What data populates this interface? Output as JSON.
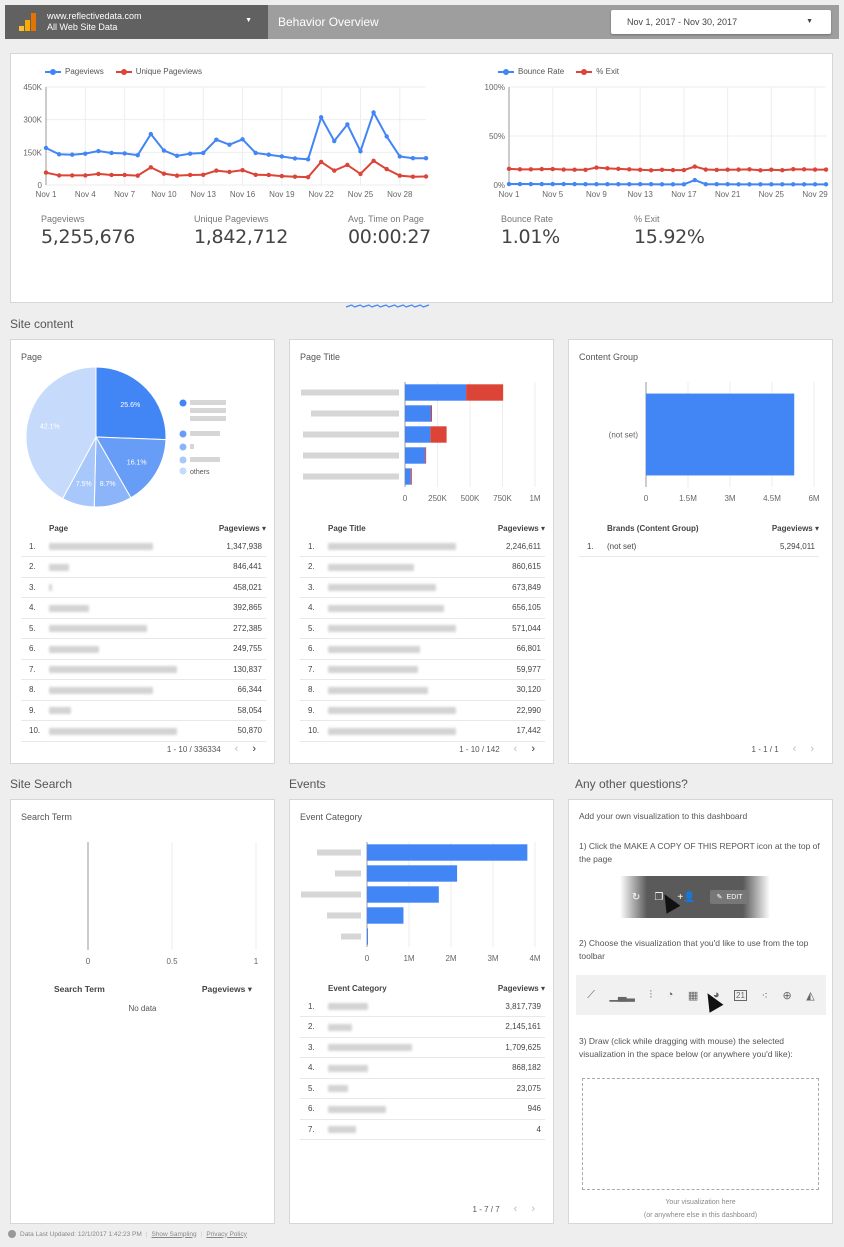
{
  "header": {
    "site": "www.reflectivedata.com",
    "view": "All Web Site Data",
    "title": "Behavior Overview",
    "date_range": "Nov 1, 2017 - Nov 30, 2017"
  },
  "colors": {
    "blue": "#4285f4",
    "red": "#db4437",
    "pie": [
      "#4285f4",
      "#679df6",
      "#8cb4f8",
      "#a8c7fa",
      "#c6dafc"
    ]
  },
  "overview": {
    "scorecards": [
      {
        "label": "Pageviews",
        "value": "5,255,676"
      },
      {
        "label": "Unique Pageviews",
        "value": "1,842,712"
      },
      {
        "label": "Avg. Time on Page",
        "value": "00:00:27"
      },
      {
        "label": "Bounce Rate",
        "value": "1.01%"
      },
      {
        "label": "% Exit",
        "value": "15.92%"
      }
    ]
  },
  "sections": {
    "site_content": "Site content",
    "site_search": "Site Search",
    "events": "Events",
    "questions": "Any other questions?"
  },
  "page_card": {
    "title": "Page",
    "legend_others": "others",
    "table": {
      "headers": [
        "Page",
        "Pageviews ▾"
      ],
      "rows": [
        {
          "n": "1.",
          "name_width": 104,
          "value": "1,347,938"
        },
        {
          "n": "2.",
          "name_width": 20,
          "value": "846,441"
        },
        {
          "n": "3.",
          "name_width": 3,
          "value": "458,021"
        },
        {
          "n": "4.",
          "name_width": 40,
          "value": "392,865"
        },
        {
          "n": "5.",
          "name_width": 98,
          "value": "272,385"
        },
        {
          "n": "6.",
          "name_width": 50,
          "value": "249,755"
        },
        {
          "n": "7.",
          "name_width": 128,
          "value": "130,837"
        },
        {
          "n": "8.",
          "name_width": 104,
          "value": "66,344"
        },
        {
          "n": "9.",
          "name_width": 22,
          "value": "58,054"
        },
        {
          "n": "10.",
          "name_width": 128,
          "value": "50,870"
        }
      ],
      "pager": "1 - 10 / 336334"
    }
  },
  "page_title_card": {
    "title": "Page Title",
    "table": {
      "headers": [
        "Page Title",
        "Pageviews ▾"
      ],
      "rows": [
        {
          "n": "1.",
          "name_width": 128,
          "value": "2,246,611"
        },
        {
          "n": "2.",
          "name_width": 86,
          "value": "860,615"
        },
        {
          "n": "3.",
          "name_width": 108,
          "value": "673,849"
        },
        {
          "n": "4.",
          "name_width": 116,
          "value": "656,105"
        },
        {
          "n": "5.",
          "name_width": 128,
          "value": "571,044"
        },
        {
          "n": "6.",
          "name_width": 92,
          "value": "66,801"
        },
        {
          "n": "7.",
          "name_width": 90,
          "value": "59,977"
        },
        {
          "n": "8.",
          "name_width": 100,
          "value": "30,120"
        },
        {
          "n": "9.",
          "name_width": 128,
          "value": "22,990"
        },
        {
          "n": "10.",
          "name_width": 128,
          "value": "17,442"
        }
      ],
      "pager": "1 - 10 / 142"
    }
  },
  "content_group_card": {
    "title": "Content Group",
    "table": {
      "headers": [
        "Brands (Content Group)",
        "Pageviews ▾"
      ],
      "rows": [
        {
          "n": "1.",
          "name": "(not set)",
          "value": "5,294,011"
        }
      ],
      "pager": "1 - 1 / 1"
    }
  },
  "search_card": {
    "title": "Search Term",
    "table": {
      "headers": [
        "Search Term",
        "Pageviews ▾"
      ],
      "empty": "No data"
    }
  },
  "events_card": {
    "title": "Event Category",
    "table": {
      "headers": [
        "Event Category",
        "Pageviews ▾"
      ],
      "rows": [
        {
          "n": "1.",
          "name_width": 40,
          "value": "3,817,739"
        },
        {
          "n": "2.",
          "name_width": 24,
          "value": "2,145,161"
        },
        {
          "n": "3.",
          "name_width": 84,
          "value": "1,709,625"
        },
        {
          "n": "4.",
          "name_width": 40,
          "value": "868,182"
        },
        {
          "n": "5.",
          "name_width": 20,
          "value": "23,075"
        },
        {
          "n": "6.",
          "name_width": 58,
          "value": "946"
        },
        {
          "n": "7.",
          "name_width": 28,
          "value": "4"
        }
      ],
      "pager": "1 - 7 / 7"
    }
  },
  "questions_card": {
    "intro": "Add your own visualization to this dashboard",
    "step1": "1) Click the MAKE A COPY OF THIS REPORT icon at the top of the page",
    "step1_edit": "EDIT",
    "step2": "2) Choose the visualization that you'd like to use from the top toolbar",
    "step3": "3) Draw (click while dragging with mouse) the selected visualization in the space below (or anywhere you'd like):",
    "placeholder1": "Your visualization here",
    "placeholder2": "(or anywhere else in this dashboard)",
    "toolbar_icons": [
      "time-series-icon",
      "bar-chart-icon",
      "combo-chart-icon",
      "pie-chart-icon",
      "table-icon",
      "geo-map-icon",
      "scorecard-icon",
      "scatter-chart-icon",
      "bullet-chart-icon",
      "area-chart-icon"
    ]
  },
  "footer": {
    "updated": "Data Last Updated: 12/1/2017 1:42:23 PM",
    "sampling": "Show Sampling",
    "privacy": "Privacy Policy"
  },
  "chart_data": [
    {
      "type": "line",
      "title": "",
      "x": [
        "Nov 1",
        "Nov 2",
        "Nov 3",
        "Nov 4",
        "Nov 5",
        "Nov 6",
        "Nov 7",
        "Nov 8",
        "Nov 9",
        "Nov 10",
        "Nov 11",
        "Nov 12",
        "Nov 13",
        "Nov 14",
        "Nov 15",
        "Nov 16",
        "Nov 17",
        "Nov 18",
        "Nov 19",
        "Nov 20",
        "Nov 21",
        "Nov 22",
        "Nov 23",
        "Nov 24",
        "Nov 25",
        "Nov 26",
        "Nov 27",
        "Nov 28",
        "Nov 29",
        "Nov 30"
      ],
      "xticks": [
        "Nov 1",
        "Nov 4",
        "Nov 7",
        "Nov 10",
        "Nov 13",
        "Nov 16",
        "Nov 19",
        "Nov 22",
        "Nov 25",
        "Nov 28"
      ],
      "yticks": [
        "0",
        "150K",
        "300K",
        "450K"
      ],
      "ylim": [
        0,
        450000
      ],
      "legend": "top-left",
      "series": [
        {
          "name": "Pageviews",
          "color": "#4285f4",
          "values": [
            170000,
            141000,
            139000,
            144000,
            156000,
            147000,
            145000,
            137000,
            234000,
            158000,
            134000,
            144000,
            147000,
            208000,
            185000,
            210000,
            147000,
            139000,
            131000,
            122000,
            118000,
            311000,
            202000,
            278000,
            155000,
            333000,
            223000,
            131000,
            123000,
            123000
          ]
        },
        {
          "name": "Unique Pageviews",
          "color": "#db4437",
          "values": [
            57000,
            44000,
            44000,
            44000,
            51000,
            46000,
            46000,
            43000,
            81000,
            52000,
            43000,
            46000,
            47000,
            66000,
            60000,
            68000,
            47000,
            46000,
            41000,
            38000,
            36000,
            106000,
            66000,
            92000,
            51000,
            111000,
            73000,
            43000,
            38000,
            39000
          ]
        }
      ]
    },
    {
      "type": "line",
      "title": "",
      "x": [
        "Nov 1",
        "Nov 2",
        "Nov 3",
        "Nov 4",
        "Nov 5",
        "Nov 6",
        "Nov 7",
        "Nov 8",
        "Nov 9",
        "Nov 10",
        "Nov 11",
        "Nov 12",
        "Nov 13",
        "Nov 14",
        "Nov 15",
        "Nov 16",
        "Nov 17",
        "Nov 18",
        "Nov 19",
        "Nov 20",
        "Nov 21",
        "Nov 22",
        "Nov 23",
        "Nov 24",
        "Nov 25",
        "Nov 26",
        "Nov 27",
        "Nov 28",
        "Nov 29",
        "Nov 30"
      ],
      "xticks": [
        "Nov 1",
        "Nov 5",
        "Nov 9",
        "Nov 13",
        "Nov 17",
        "Nov 21",
        "Nov 25",
        "Nov 29"
      ],
      "yticks": [
        "0%",
        "50%",
        "100%"
      ],
      "ylim": [
        0,
        100
      ],
      "legend": "top-left",
      "series": [
        {
          "name": "Bounce Rate",
          "color": "#4285f4",
          "values": [
            1.0,
            1.0,
            1.0,
            0.9,
            0.9,
            1.0,
            0.9,
            0.8,
            0.8,
            0.8,
            0.8,
            0.8,
            0.8,
            0.8,
            0.7,
            0.7,
            0.7,
            5.0,
            0.8,
            0.8,
            0.8,
            0.7,
            0.7,
            0.7,
            0.7,
            0.7,
            0.7,
            0.7,
            0.7,
            0.7
          ]
        },
        {
          "name": "% Exit",
          "color": "#db4437",
          "values": [
            16.5,
            16.0,
            16.0,
            16.2,
            16.3,
            15.8,
            15.6,
            15.5,
            17.8,
            17.0,
            16.5,
            16.0,
            15.5,
            15.0,
            15.5,
            15.2,
            15.2,
            18.8,
            15.8,
            15.4,
            15.6,
            15.7,
            16.0,
            15.0,
            15.6,
            15.1,
            16.1,
            16.0,
            15.7,
            15.7
          ]
        }
      ]
    },
    {
      "type": "pie",
      "title": "Page",
      "labels": [
        "(redacted page 1)",
        "(redacted page 2)",
        "(redacted page 3)",
        "(redacted page 4)",
        "others"
      ],
      "values": [
        25.6,
        16.1,
        8.7,
        7.5,
        42.1
      ],
      "value_labels": [
        "25.6%",
        "16.1%",
        "8.7%",
        "7.5%",
        "42.1%"
      ],
      "legend": "right"
    },
    {
      "type": "bar",
      "orientation": "horizontal",
      "stacked": true,
      "title": "Page Title",
      "categories": [
        "(redacted 1)",
        "(redacted 2)",
        "(redacted 3)",
        "(redacted 4)",
        "(redacted 5)"
      ],
      "series": [
        {
          "name": "segment-1",
          "color": "#4285f4",
          "values": [
            470000,
            200000,
            195000,
            155000,
            45000
          ]
        },
        {
          "name": "segment-2",
          "color": "#db4437",
          "values": [
            285000,
            3000,
            125000,
            3000,
            3000
          ]
        }
      ],
      "xticks": [
        "0",
        "250K",
        "500K",
        "750K",
        "1M"
      ],
      "xlim": [
        0,
        1000000
      ]
    },
    {
      "type": "bar",
      "orientation": "horizontal",
      "title": "Content Group",
      "categories": [
        "(not set)"
      ],
      "values": [
        5294011
      ],
      "xticks": [
        "0",
        "1.5M",
        "3M",
        "4.5M",
        "6M"
      ],
      "xlim": [
        0,
        6000000
      ]
    },
    {
      "type": "bar",
      "orientation": "horizontal",
      "title": "Search Term",
      "categories": [],
      "values": [],
      "xticks": [
        "0",
        "0.5",
        "1"
      ],
      "xlim": [
        0,
        1
      ]
    },
    {
      "type": "bar",
      "orientation": "horizontal",
      "title": "Event Category",
      "categories": [
        "(redacted 1)",
        "(redacted 2)",
        "(redacted 3)",
        "(redacted 4)",
        "(redacted 5)"
      ],
      "values": [
        3817739,
        2145161,
        1709625,
        868182,
        23075
      ],
      "xticks": [
        "0",
        "1M",
        "2M",
        "3M",
        "4M"
      ],
      "xlim": [
        0,
        4000000
      ]
    }
  ]
}
